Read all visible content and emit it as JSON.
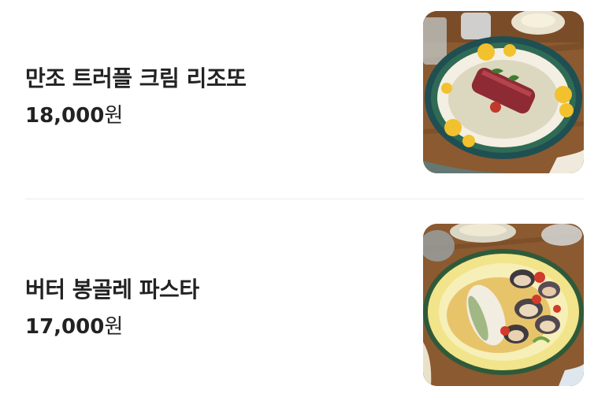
{
  "menu": {
    "items": [
      {
        "name": "만조 트러플 크림 리조또",
        "price": "18,000",
        "currency": "원",
        "image": "risotto-photo"
      },
      {
        "name": "버터 봉골레 파스타",
        "price": "17,000",
        "currency": "원",
        "image": "vongole-pasta-photo"
      }
    ]
  },
  "colors": {
    "text": "#222222",
    "divider": "#ececec",
    "table_wood": "#8a5a33",
    "plate_rim_teal": "#1f4f52",
    "plate_rim_yellow": "#f1e48a"
  }
}
